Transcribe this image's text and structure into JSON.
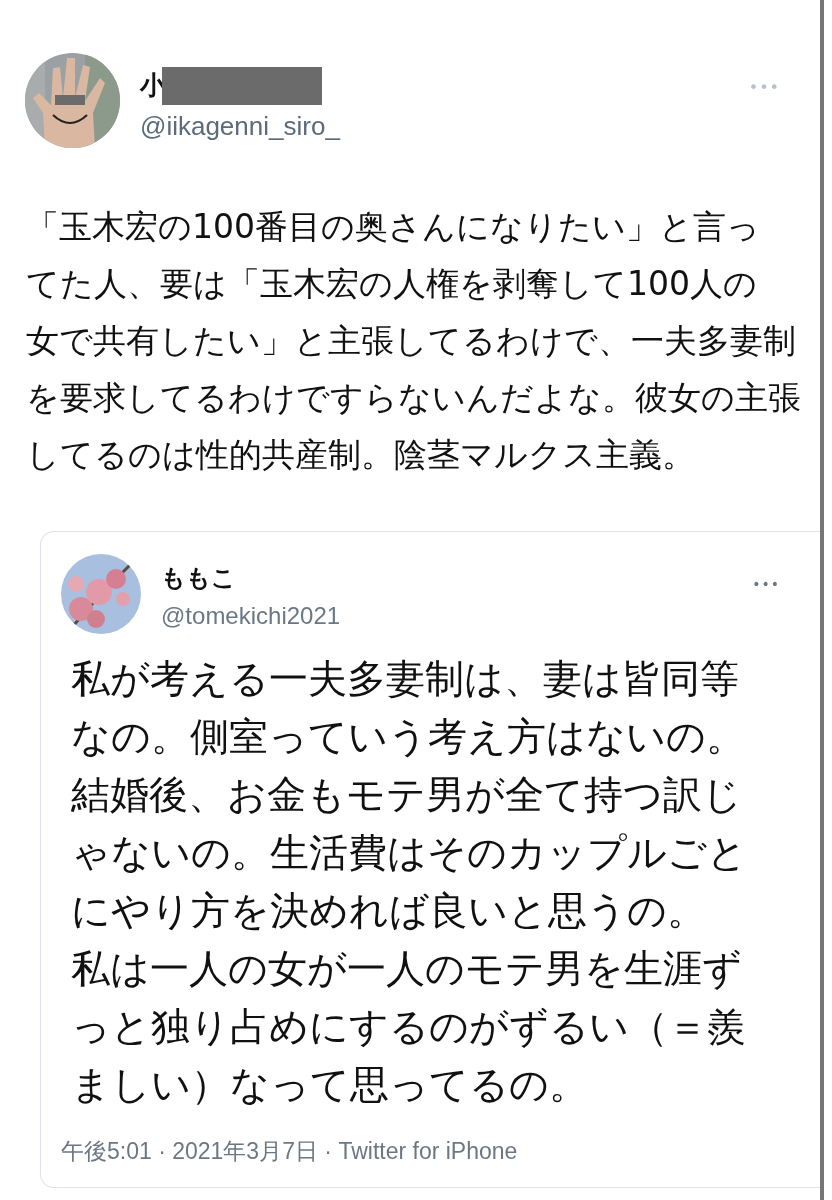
{
  "tweet": {
    "author": {
      "name": "小",
      "handle": "@iikagenni_siro_",
      "redacted": true
    },
    "more": "•••",
    "text_lines": [
      "「玉木宏の100番目の奥さんになりたい」と言っ",
      "てた人、要は「玉木宏の人権を剥奪して100人の",
      "女で共有したい」と主張してるわけで、一夫多妻制",
      "を要求してるわけですらないんだよな。彼女の主張",
      "してるのは性的共産制。陰茎マルクス主義。"
    ],
    "quote": {
      "author": {
        "name": "ももこ",
        "handle": "@tomekichi2021"
      },
      "more": "•••",
      "text_lines": [
        "私が考える一夫多妻制は、妻は皆同等",
        "なの。側室っていう考え方はないの。",
        "結婚後、お金もモテ男が全て持つ訳じ",
        "ゃないの。生活費はそのカップルごと",
        "にやり方を決めれば良いと思うの。",
        "私は一人の女が一人のモテ男を生涯ず",
        "っと独り占めにするのがずるい（＝羨",
        "ましい）なって思ってるの。"
      ],
      "timestamp": "午後5:01 · 2021年3月7日 · Twitter for iPhone"
    }
  }
}
